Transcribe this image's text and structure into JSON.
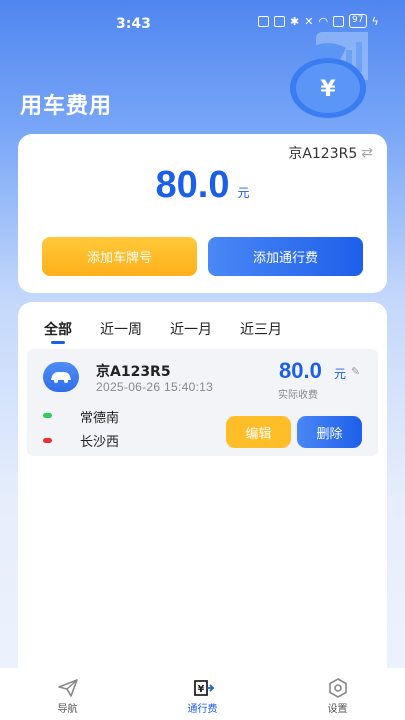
{
  "status": {
    "time": "3:43",
    "battery": "97"
  },
  "page": {
    "title": "用车费用"
  },
  "summary": {
    "plate": "京A123R5",
    "swap_symbol": "⇄",
    "total": "80.0",
    "unit": "元",
    "add_plate_label": "添加车牌号",
    "add_toll_label": "添加通行费"
  },
  "tabs": [
    {
      "label": "全部",
      "active": true
    },
    {
      "label": "近一周",
      "active": false
    },
    {
      "label": "近一月",
      "active": false
    },
    {
      "label": "近三月",
      "active": false
    }
  ],
  "records": [
    {
      "plate": "京A123R5",
      "time": "2025-06-26 15:40:13",
      "amount": "80.0",
      "unit": "元",
      "amount_label": "实际收费",
      "from": "常德南",
      "to": "长沙西",
      "edit_label": "编辑",
      "delete_label": "删除"
    }
  ],
  "nav": [
    {
      "label": "导航",
      "icon": "send-icon",
      "active": false
    },
    {
      "label": "通行费",
      "icon": "yuan-toll-icon",
      "active": true
    },
    {
      "label": "设置",
      "icon": "settings-icon",
      "active": false
    }
  ],
  "colors": {
    "accent": "#1b5ee8",
    "warn": "#ffbd27",
    "start_dot": "#2ccf5a",
    "end_dot": "#ee2e2e"
  }
}
